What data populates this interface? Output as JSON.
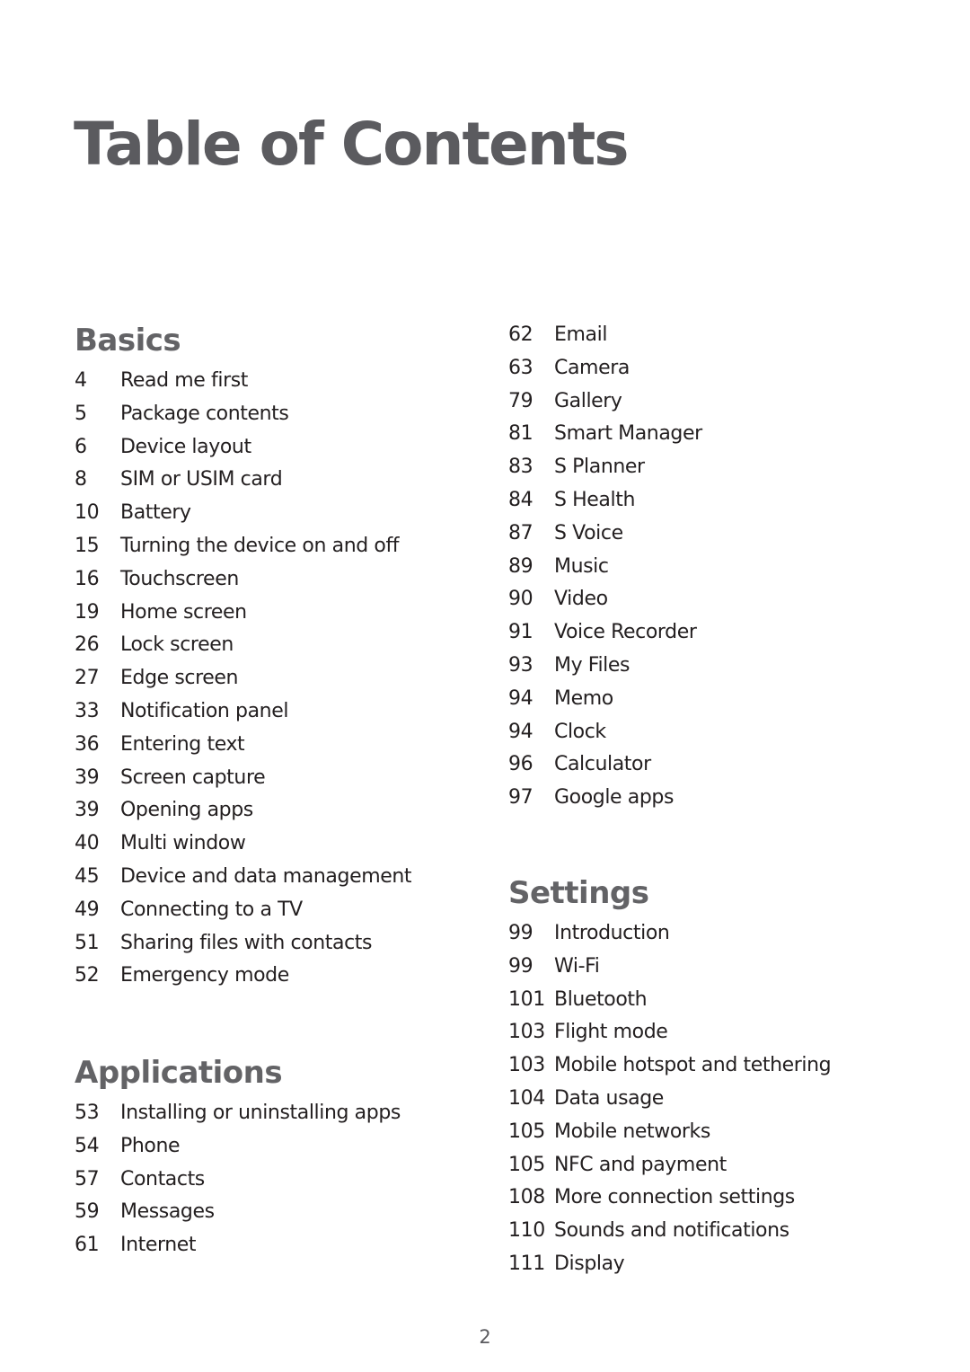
{
  "document": {
    "title": "Table of Contents",
    "page_number": "2"
  },
  "sections": {
    "basics": {
      "heading": "Basics",
      "entries": [
        {
          "page": "4",
          "label": "Read me first"
        },
        {
          "page": "5",
          "label": "Package contents"
        },
        {
          "page": "6",
          "label": "Device layout"
        },
        {
          "page": "8",
          "label": "SIM or USIM card"
        },
        {
          "page": "10",
          "label": "Battery"
        },
        {
          "page": "15",
          "label": "Turning the device on and off"
        },
        {
          "page": "16",
          "label": "Touchscreen"
        },
        {
          "page": "19",
          "label": "Home screen"
        },
        {
          "page": "26",
          "label": "Lock screen"
        },
        {
          "page": "27",
          "label": "Edge screen"
        },
        {
          "page": "33",
          "label": "Notification panel"
        },
        {
          "page": "36",
          "label": "Entering text"
        },
        {
          "page": "39",
          "label": "Screen capture"
        },
        {
          "page": "39",
          "label": "Opening apps"
        },
        {
          "page": "40",
          "label": "Multi window"
        },
        {
          "page": "45",
          "label": "Device and data management"
        },
        {
          "page": "49",
          "label": "Connecting to a TV"
        },
        {
          "page": "51",
          "label": "Sharing files with contacts"
        },
        {
          "page": "52",
          "label": "Emergency mode"
        }
      ]
    },
    "applications": {
      "heading": "Applications",
      "entries": [
        {
          "page": "53",
          "label": "Installing or uninstalling apps"
        },
        {
          "page": "54",
          "label": "Phone"
        },
        {
          "page": "57",
          "label": "Contacts"
        },
        {
          "page": "59",
          "label": "Messages"
        },
        {
          "page": "61",
          "label": "Internet"
        },
        {
          "page": "62",
          "label": "Email"
        },
        {
          "page": "63",
          "label": "Camera"
        },
        {
          "page": "79",
          "label": "Gallery"
        },
        {
          "page": "81",
          "label": "Smart Manager"
        },
        {
          "page": "83",
          "label": "S Planner"
        },
        {
          "page": "84",
          "label": "S Health"
        },
        {
          "page": "87",
          "label": "S Voice"
        },
        {
          "page": "89",
          "label": "Music"
        },
        {
          "page": "90",
          "label": "Video"
        },
        {
          "page": "91",
          "label": "Voice Recorder"
        },
        {
          "page": "93",
          "label": "My Files"
        },
        {
          "page": "94",
          "label": "Memo"
        },
        {
          "page": "94",
          "label": "Clock"
        },
        {
          "page": "96",
          "label": "Calculator"
        },
        {
          "page": "97",
          "label": "Google apps"
        }
      ]
    },
    "settings": {
      "heading": "Settings",
      "entries": [
        {
          "page": "99",
          "label": "Introduction"
        },
        {
          "page": "99",
          "label": "Wi-Fi"
        },
        {
          "page": "101",
          "label": "Bluetooth"
        },
        {
          "page": "103",
          "label": "Flight mode"
        },
        {
          "page": "103",
          "label": "Mobile hotspot and tethering"
        },
        {
          "page": "104",
          "label": "Data usage"
        },
        {
          "page": "105",
          "label": "Mobile networks"
        },
        {
          "page": "105",
          "label": "NFC and payment"
        },
        {
          "page": "108",
          "label": "More connection settings"
        },
        {
          "page": "110",
          "label": "Sounds and notifications"
        },
        {
          "page": "111",
          "label": "Display"
        }
      ]
    }
  }
}
